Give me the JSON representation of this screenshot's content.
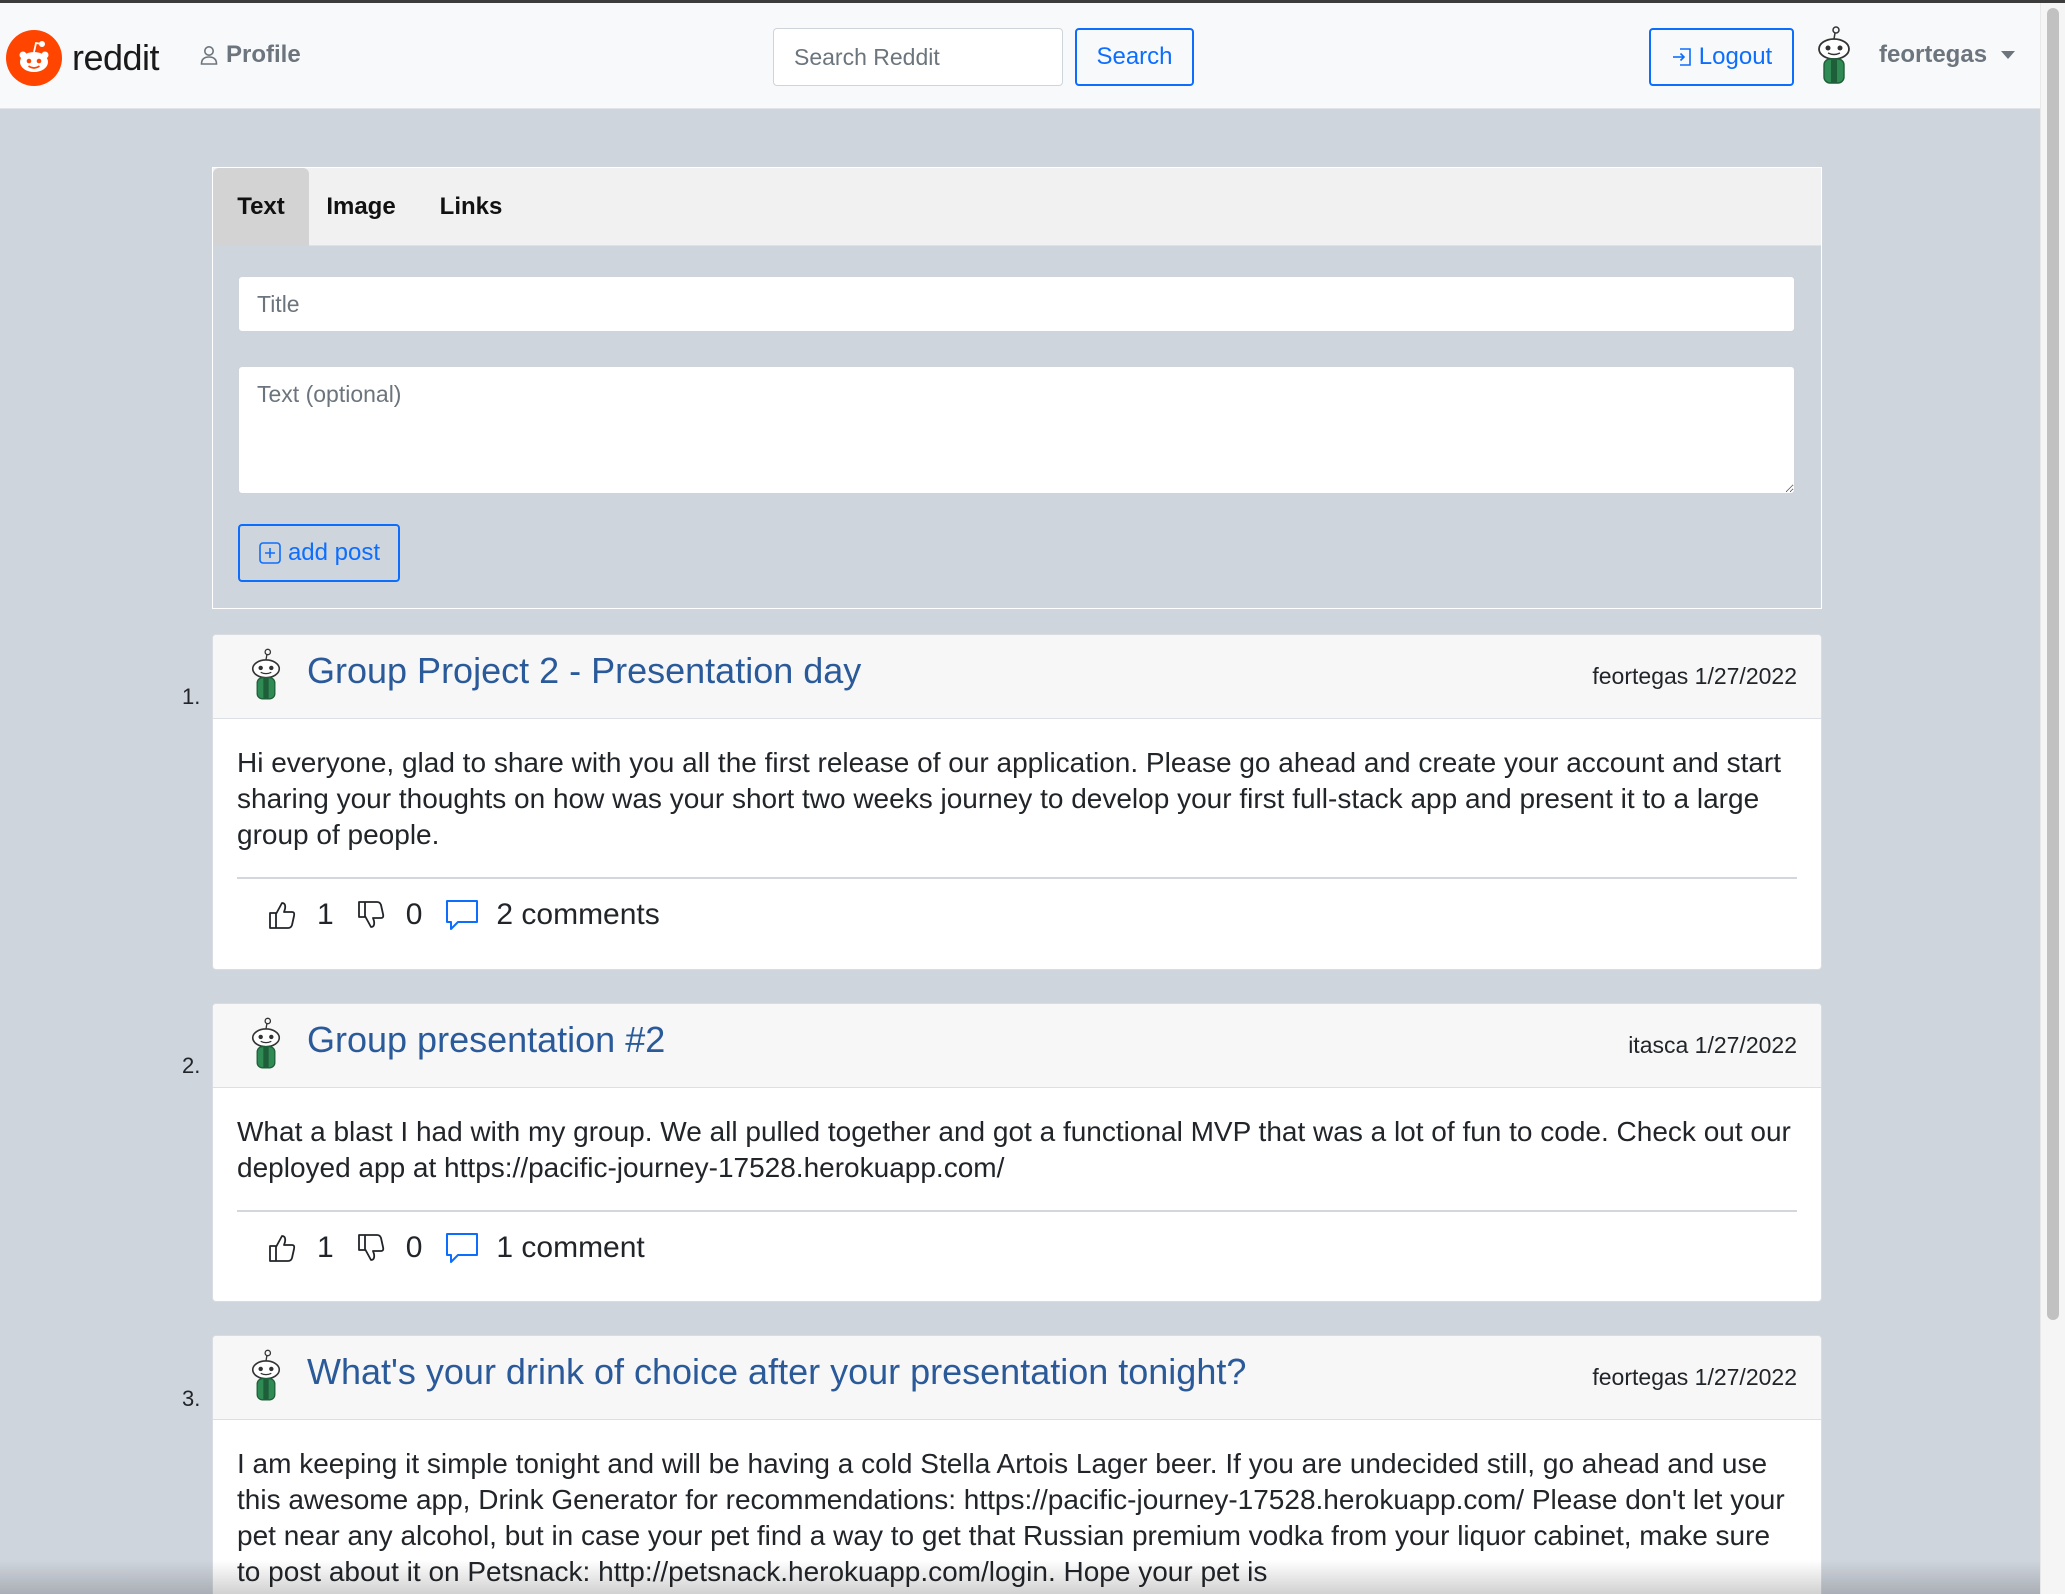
{
  "navbar": {
    "brand": "reddit",
    "profile_label": "Profile",
    "search_placeholder": "Search Reddit",
    "search_label": "Search",
    "logout_label": "Logout",
    "username": "feortegas"
  },
  "composer": {
    "tabs": [
      {
        "label": "Text",
        "active": true
      },
      {
        "label": "Image",
        "active": false
      },
      {
        "label": "Links",
        "active": false
      }
    ],
    "title_placeholder": "Title",
    "text_placeholder": "Text (optional)",
    "add_post_label": "add post"
  },
  "posts": [
    {
      "number": "1.",
      "title": "Group Project 2 - Presentation day",
      "author": "feortegas",
      "date": "1/27/2022",
      "body": "Hi everyone, glad to share with you all the first release of our application. Please go ahead and create your account and start sharing your thoughts on how was your short two weeks journey to develop your first full-stack app and present it to a large group of people.",
      "likes": "1",
      "dislikes": "0",
      "comments": "2 comments"
    },
    {
      "number": "2.",
      "title": "Group presentation #2",
      "author": "itasca",
      "date": "1/27/2022",
      "body": "What a blast I had with my group. We all pulled together and got a functional MVP that was a lot of fun to code. Check out our deployed app at https://pacific-journey-17528.herokuapp.com/",
      "likes": "1",
      "dislikes": "0",
      "comments": "1 comment"
    },
    {
      "number": "3.",
      "title": "What's your drink of choice after your presentation tonight?",
      "author": "feortegas",
      "date": "1/27/2022",
      "body": "I am keeping it simple tonight and will be having a cold Stella Artois Lager beer. If you are undecided still, go ahead and use this awesome app, Drink Generator for recommendations: https://pacific-journey-17528.herokuapp.com/ Please don't let your pet near any alcohol, but in case your pet find a way to get that Russian premium vodka from your liquor cabinet, make sure to post about it on Petsnack: http://petsnack.herokuapp.com/login. Hope your pet is"
    }
  ],
  "colors": {
    "brand_orange": "#ff4500",
    "primary_blue": "#0d6efd",
    "title_blue": "#2a5a99",
    "page_bg": "#cfd5dd"
  },
  "icons": [
    "reddit-logo-icon",
    "person-icon",
    "logout-icon",
    "snoo-avatar-icon",
    "plus-square-icon",
    "thumbs-up-icon",
    "thumbs-down-icon",
    "comment-icon",
    "chevron-down-icon"
  ]
}
